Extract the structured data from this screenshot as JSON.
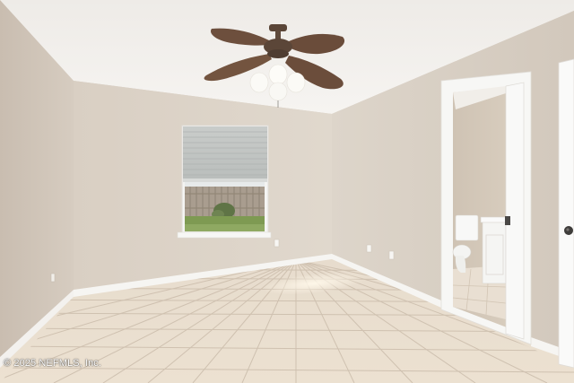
{
  "watermark": {
    "text": "© 2025 NEFMLS, Inc."
  },
  "colors": {
    "ceiling": "#f3f1ee",
    "back_wall": "#ddd4c9",
    "left_wall": "#d3c9bd",
    "right_wall": "#d9d0c5",
    "baseboard": "#f6f5f2",
    "floor_tile": "#e9dccb",
    "grout": "#cdbfae",
    "trim": "#f8f8f6",
    "fan_blade": "#6d4f3d"
  }
}
